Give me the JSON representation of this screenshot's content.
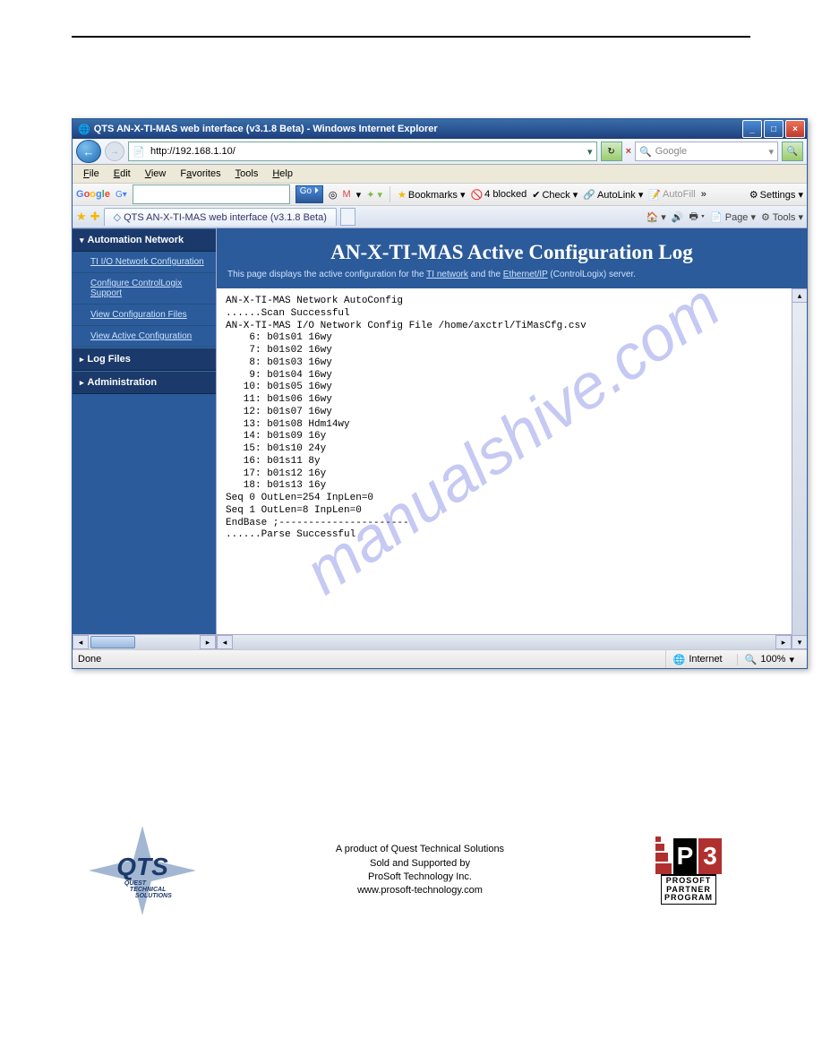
{
  "titlebar": {
    "title": "QTS AN-X-TI-MAS web interface (v3.1.8 Beta) - Windows Internet Explorer",
    "min": "_",
    "max": "□",
    "close": "×"
  },
  "navbar": {
    "back": "←",
    "forward": "→",
    "url": "http://192.168.1.10/",
    "goIcon": "→",
    "refreshIcon": "↻",
    "stopIcon": "×",
    "searchPlaceholder": "Google",
    "searchGo": "🔍"
  },
  "menubar": {
    "file": "File",
    "edit": "Edit",
    "view": "View",
    "favorites": "Favorites",
    "tools": "Tools",
    "help": "Help"
  },
  "googlebar": {
    "logo": "Google",
    "go": "Go ⏵",
    "bookmarks": "Bookmarks ▾",
    "blocked": "4 blocked",
    "check": "Check ▾",
    "autolink": "AutoLink ▾",
    "autofill": "AutoFill",
    "settings": "Settings ▾"
  },
  "tabbar": {
    "tab_title": "QTS AN-X-TI-MAS web interface (v3.1.8 Beta)",
    "home": "🏠 ▾",
    "rss": "🔊",
    "print": "🖶 ▾",
    "page": "Page ▾",
    "tools": "Tools ▾"
  },
  "sidebar": {
    "sections": [
      {
        "label": "Automation Network",
        "open": true,
        "items": [
          {
            "label": "TI I/O Network Configuration"
          },
          {
            "label": "Configure ControlLogix Support"
          },
          {
            "label": "View Configuration Files"
          },
          {
            "label": "View Active Configuration"
          }
        ]
      },
      {
        "label": "Log Files",
        "open": false,
        "items": []
      },
      {
        "label": "Administration",
        "open": false,
        "items": []
      }
    ]
  },
  "main": {
    "heading": "AN-X-TI-MAS Active Configuration Log",
    "subtext_pre": "This page displays the active configuration for the ",
    "link1": "TI network",
    "subtext_mid": " and the ",
    "link2": "Ethernet/IP",
    "subtext_post": " (ControlLogix) server.",
    "log": "AN-X-TI-MAS Network AutoConfig\n......Scan Successful\nAN-X-TI-MAS I/O Network Config File /home/axctrl/TiMasCfg.csv\n    6: b01s01 16wy\n    7: b01s02 16wy\n    8: b01s03 16wy\n    9: b01s04 16wy\n   10: b01s05 16wy\n   11: b01s06 16wy\n   12: b01s07 16wy\n   13: b01s08 Hdm14wy\n   14: b01s09 16y\n   15: b01s10 24y\n   16: b01s11 8y\n   17: b01s12 16y\n   18: b01s13 16y\nSeq 0 OutLen=254 InpLen=0\nSeq 1 OutLen=8 InpLen=0\nEndBase ;----------------------\n......Parse Successful"
  },
  "statusbar": {
    "done": "Done",
    "zone": "Internet",
    "zoneIcon": "🌐",
    "zoom": "100%",
    "zoomIcon": "🔍"
  },
  "watermark": "manualshive.com",
  "footer": {
    "line1": "A product of Quest Technical Solutions",
    "line2": "Sold and Supported by",
    "line3": "ProSoft Technology Inc.",
    "line4": "www.prosoft-technology.com",
    "qts_text": "QTS",
    "qts_sub1": "QUEST",
    "qts_sub2": "TECHNICAL",
    "qts_sub3": "SOLUTIONS",
    "p3_p": "P",
    "p3_3": "3",
    "p3_t1": "PROSOFT",
    "p3_t2": "PARTNER",
    "p3_t3": "PROGRAM"
  }
}
